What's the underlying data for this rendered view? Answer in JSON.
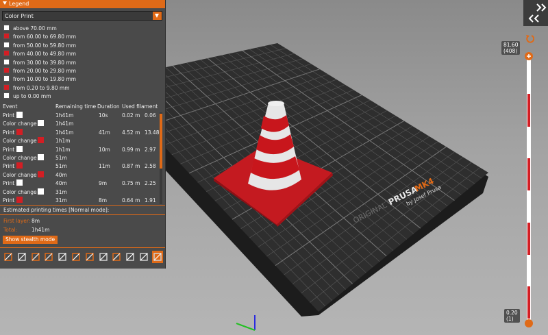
{
  "legend": {
    "title": "Legend",
    "view_type": "Color Print",
    "ranges": [
      {
        "label": "above 70.00 mm",
        "color": "#ffffff"
      },
      {
        "label": "from 60.00 to 69.80 mm",
        "color": "#d31e24"
      },
      {
        "label": "from 50.00 to 59.80 mm",
        "color": "#ffffff"
      },
      {
        "label": "from 40.00 to 49.80 mm",
        "color": "#d31e24"
      },
      {
        "label": "from 30.00 to 39.80 mm",
        "color": "#ffffff"
      },
      {
        "label": "from 20.00 to 29.80 mm",
        "color": "#d31e24"
      },
      {
        "label": "from 10.00 to 19.80 mm",
        "color": "#ffffff"
      },
      {
        "label": "from 0.20 to 9.80 mm",
        "color": "#d31e24"
      },
      {
        "label": "up to 0.00 mm",
        "color": "#ffffff"
      }
    ],
    "columns": [
      "Event",
      "Remaining time",
      "Duration",
      "Used filament"
    ],
    "rows": [
      {
        "event": "Print",
        "colors": [
          "#ffffff"
        ],
        "remaining": "1h41m",
        "duration": "10s",
        "length": "0.02 m",
        "weight": "0.06"
      },
      {
        "event": "Color change",
        "colors": [
          "#d31e24",
          "#ffffff"
        ],
        "remaining": "1h41m",
        "duration": "",
        "length": "",
        "weight": ""
      },
      {
        "event": "Print",
        "colors": [
          "#d31e24"
        ],
        "remaining": "1h41m",
        "duration": "41m",
        "length": "4.52 m",
        "weight": "13.48"
      },
      {
        "event": "Color change",
        "colors": [
          "#ffffff",
          "#d31e24"
        ],
        "remaining": "1h1m",
        "duration": "",
        "length": "",
        "weight": ""
      },
      {
        "event": "Print",
        "colors": [
          "#ffffff"
        ],
        "remaining": "1h1m",
        "duration": "10m",
        "length": "0.99 m",
        "weight": "2.97"
      },
      {
        "event": "Color change",
        "colors": [
          "#d31e24",
          "#ffffff"
        ],
        "remaining": "51m",
        "duration": "",
        "length": "",
        "weight": ""
      },
      {
        "event": "Print",
        "colors": [
          "#d31e24"
        ],
        "remaining": "51m",
        "duration": "11m",
        "length": "0.87 m",
        "weight": "2.58"
      },
      {
        "event": "Color change",
        "colors": [
          "#ffffff",
          "#d31e24"
        ],
        "remaining": "40m",
        "duration": "",
        "length": "",
        "weight": ""
      },
      {
        "event": "Print",
        "colors": [
          "#ffffff"
        ],
        "remaining": "40m",
        "duration": "9m",
        "length": "0.75 m",
        "weight": "2.25"
      },
      {
        "event": "Color change",
        "colors": [
          "#d31e24",
          "#ffffff"
        ],
        "remaining": "31m",
        "duration": "",
        "length": "",
        "weight": ""
      },
      {
        "event": "Print",
        "colors": [
          "#d31e24"
        ],
        "remaining": "31m",
        "duration": "8m",
        "length": "0.64 m",
        "weight": "1.91"
      }
    ],
    "estimated_label": "Estimated printing times [Normal mode]:",
    "first_layer_label": "First layer:",
    "first_layer_value": "8m",
    "total_label": "Total:",
    "total_value": "1h41m",
    "stealth_button": "Show stealth mode",
    "toolbar_icons": [
      "travel-icon",
      "wipe-icon",
      "retractions-icon",
      "deretractions-icon",
      "seams-icon",
      "tool-changes-icon",
      "color-changes-icon",
      "pause-prints-icon",
      "custom-gcodes-icon",
      "center-of-gravity-icon",
      "shells-icon",
      "tool-marker-icon"
    ]
  },
  "bed": {
    "brand_original": "ORIGINAL",
    "brand_prusa": "PRUSA",
    "brand_model": "MK4",
    "brand_by": "by Josef Prusa"
  },
  "layer_slider": {
    "top_height": "81.60",
    "top_layer": "(408)",
    "bottom_height": "0.20",
    "bottom_layer": "(1)",
    "accent": "#e06a17"
  },
  "colors": {
    "accent": "#e06a17",
    "red": "#d31e24",
    "white": "#ffffff"
  }
}
